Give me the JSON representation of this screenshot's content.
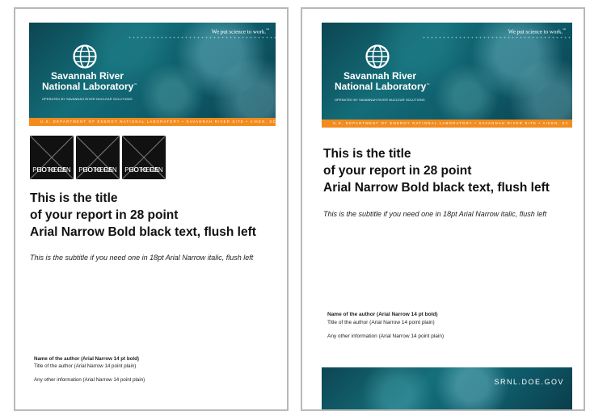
{
  "banner": {
    "tagline": "We put science to work.",
    "tagline_mark": "™",
    "logo_line1": "Savannah River",
    "logo_line2": "National Laboratory",
    "logo_mark": "™",
    "operated_by": "OPERATED BY SAVANNAH RIVER NUCLEAR SOLUTIONS",
    "orange_bar": "U.S. DEPARTMENT OF ENERGY NATIONAL LABORATORY  •  SAVANNAH RIVER SITE  •  AIKEN, SC"
  },
  "photos": [
    {
      "line1": "PHOTO CAN",
      "line2": "GO HERE"
    },
    {
      "line1": "PHOTO CAN",
      "line2": "GO HERE"
    },
    {
      "line1": "PHOTO CAN",
      "line2": "GO HERE"
    }
  ],
  "title": {
    "line1": "This is the title",
    "line2": "of your report in 28 point",
    "line3": "Arial Narrow Bold black text, flush left"
  },
  "subtitle": "This is the subtitle if you need one in 18pt Arial Narrow italic, flush left",
  "author": {
    "name": "Name of the author (Arial Narrow 14 pt bold)",
    "title": "Title of the author (Arial Narrow 14 point plain)",
    "other": "Any other information (Arial Narrow 14 point plain)"
  },
  "footer": {
    "url": "SRNL.DOE.GOV"
  }
}
